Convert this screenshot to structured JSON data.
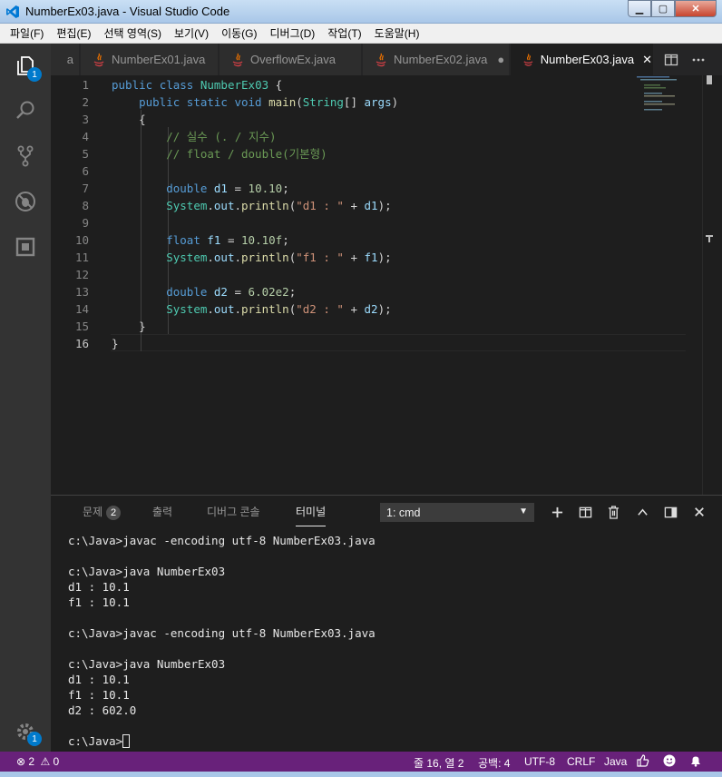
{
  "window": {
    "title": "NumberEx03.java - Visual Studio Code"
  },
  "menu": [
    "파일(F)",
    "편집(E)",
    "선택 영역(S)",
    "보기(V)",
    "이동(G)",
    "디버그(D)",
    "작업(T)",
    "도움말(H)"
  ],
  "activity": {
    "explorer_badge": "1",
    "settings_badge": "1"
  },
  "tabs": [
    {
      "label": "a",
      "active": false
    },
    {
      "label": "NumberEx01.java",
      "active": false
    },
    {
      "label": "OverflowEx.java",
      "active": false
    },
    {
      "label": "NumberEx02.java",
      "active": false,
      "marker": "●"
    },
    {
      "label": "NumberEx03.java",
      "active": true,
      "marker": "✕"
    }
  ],
  "editor": {
    "line_numbers": [
      "1",
      "2",
      "3",
      "4",
      "5",
      "6",
      "7",
      "8",
      "9",
      "10",
      "11",
      "12",
      "13",
      "14",
      "15",
      "16"
    ],
    "current_line": "16",
    "code": [
      "public class NumberEx03 {",
      "    public static void main(String[] args)",
      "    {",
      "        // 실수 (. / 지수)",
      "        // float / double(기본형)",
      "",
      "        double d1 = 10.10;",
      "        System.out.println(\"d1 : \" + d1);",
      "",
      "        float f1 = 10.10f;",
      "        System.out.println(\"f1 : \" + f1);",
      "",
      "        double d2 = 6.02e2;",
      "        System.out.println(\"d2 : \" + d2);",
      "    }",
      "}"
    ]
  },
  "panel": {
    "tabs": [
      "문제",
      "출력",
      "디버그 콘솔",
      "터미널"
    ],
    "problems_count": "2",
    "active_tab": "터미널",
    "terminal_select": "1: cmd",
    "terminal_lines": [
      "c:\\Java>javac -encoding utf-8 NumberEx03.java",
      "",
      "c:\\Java>java NumberEx03",
      "d1 : 10.1",
      "f1 : 10.1",
      "",
      "c:\\Java>javac -encoding utf-8 NumberEx03.java",
      "",
      "c:\\Java>java NumberEx03",
      "d1 : 10.1",
      "f1 : 10.1",
      "d2 : 602.0",
      "",
      "c:\\Java>"
    ]
  },
  "status": {
    "errors": "2",
    "warnings": "0",
    "position": "줄 16, 열 2",
    "spaces": "공백: 4",
    "encoding": "UTF-8",
    "eol": "CRLF",
    "language": "Java"
  },
  "colors": {
    "status_bar": "#68217a",
    "accent": "#007acc"
  }
}
